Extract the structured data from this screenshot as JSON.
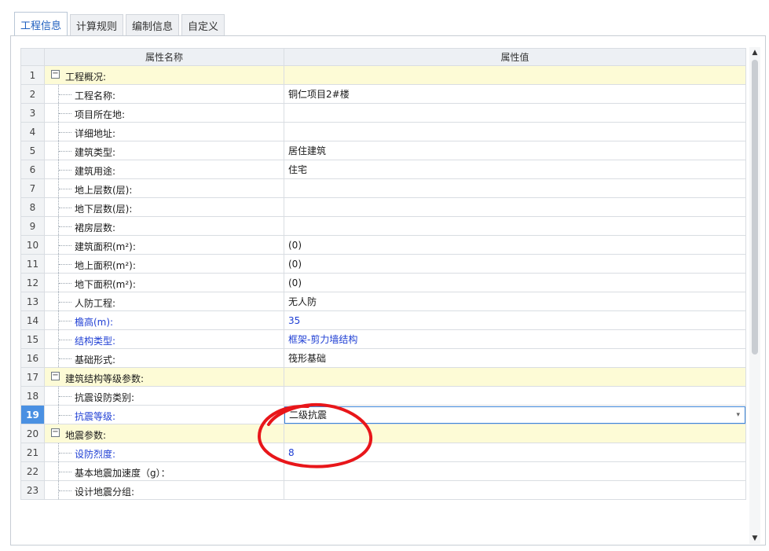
{
  "tabs": [
    "工程信息",
    "计算规则",
    "编制信息",
    "自定义"
  ],
  "active_tab": 0,
  "grid": {
    "headers": {
      "name": "属性名称",
      "value": "属性值"
    },
    "rows": [
      {
        "num": "1",
        "name": "工程概况:",
        "value": "",
        "kind": "group",
        "blue": false
      },
      {
        "num": "2",
        "name": "工程名称:",
        "value": "铜仁项目2#楼",
        "kind": "item",
        "blue": false
      },
      {
        "num": "3",
        "name": "项目所在地:",
        "value": "",
        "kind": "item",
        "blue": false
      },
      {
        "num": "4",
        "name": "详细地址:",
        "value": "",
        "kind": "item",
        "blue": false
      },
      {
        "num": "5",
        "name": "建筑类型:",
        "value": "居住建筑",
        "kind": "item",
        "blue": false
      },
      {
        "num": "6",
        "name": "建筑用途:",
        "value": "住宅",
        "kind": "item",
        "blue": false
      },
      {
        "num": "7",
        "name": "地上层数(层):",
        "value": "",
        "kind": "item",
        "blue": false
      },
      {
        "num": "8",
        "name": "地下层数(层):",
        "value": "",
        "kind": "item",
        "blue": false
      },
      {
        "num": "9",
        "name": "裙房层数:",
        "value": "",
        "kind": "item",
        "blue": false
      },
      {
        "num": "10",
        "name": "建筑面积(m²):",
        "value": "(0)",
        "kind": "item",
        "blue": false
      },
      {
        "num": "11",
        "name": "地上面积(m²):",
        "value": "(0)",
        "kind": "item",
        "blue": false
      },
      {
        "num": "12",
        "name": "地下面积(m²):",
        "value": "(0)",
        "kind": "item",
        "blue": false
      },
      {
        "num": "13",
        "name": "人防工程:",
        "value": "无人防",
        "kind": "item",
        "blue": false
      },
      {
        "num": "14",
        "name": "檐高(m):",
        "value": "35",
        "kind": "item",
        "blue": true
      },
      {
        "num": "15",
        "name": "结构类型:",
        "value": "框架-剪力墙结构",
        "kind": "item",
        "blue": true
      },
      {
        "num": "16",
        "name": "基础形式:",
        "value": "筏形基础",
        "kind": "item",
        "blue": false
      },
      {
        "num": "17",
        "name": "建筑结构等级参数:",
        "value": "",
        "kind": "group",
        "blue": false
      },
      {
        "num": "18",
        "name": "抗震设防类别:",
        "value": "",
        "kind": "item",
        "blue": false
      },
      {
        "num": "19",
        "name": "抗震等级:",
        "value": "二级抗震",
        "kind": "item",
        "blue": true,
        "active": true
      },
      {
        "num": "20",
        "name": "地震参数:",
        "value": "",
        "kind": "group",
        "blue": false
      },
      {
        "num": "21",
        "name": "设防烈度:",
        "value": "8",
        "kind": "item",
        "blue": true
      },
      {
        "num": "22",
        "name": "基本地震加速度（g）：",
        "value": "",
        "kind": "item",
        "blue": false
      },
      {
        "num": "23",
        "name": "设计地震分组:",
        "value": "",
        "kind": "item",
        "blue": false
      }
    ]
  },
  "group_toggle_symbol": "−",
  "dropdown_arrow": "▾",
  "scroll_arrows": {
    "up": "▲",
    "down": "▼"
  },
  "colors": {
    "accent_blue": "#4a97e6",
    "group_row_bg": "#fdfbd6",
    "blue_text": "#1f3fd4",
    "annotation_red": "#e8161a"
  },
  "annotation": {
    "shape": "hand-drawn-circle",
    "target_row": "19"
  }
}
